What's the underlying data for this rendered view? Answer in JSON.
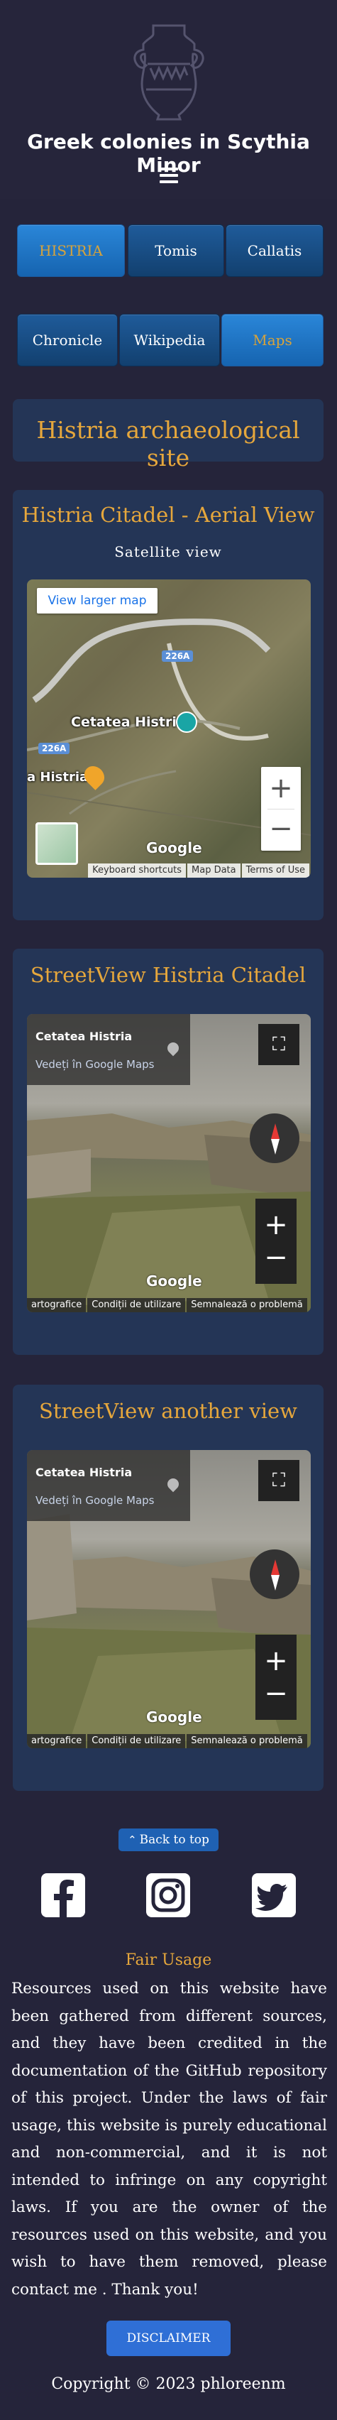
{
  "site": {
    "title": "Greek colonies in Scythia Minor"
  },
  "nav": {
    "row1": [
      "HISTRIA",
      "Tomis",
      "Callatis"
    ],
    "row2": [
      "Chronicle",
      "Wikipedia",
      "Maps"
    ],
    "active": [
      "HISTRIA",
      "Maps"
    ]
  },
  "page": {
    "title": "Histria archaeological site"
  },
  "aerial": {
    "title": "Histria Citadel - Aerial View",
    "subtitle": "Satellite view",
    "larger_map": "View larger map",
    "road1": "226A",
    "road2": "226A",
    "place": "Cetatea Histria",
    "place2": "a Histria",
    "google": "Google",
    "footer": [
      "Keyboard shortcuts",
      "Map Data",
      "Terms of Use"
    ]
  },
  "sv1": {
    "title": "StreetView Histria Citadel",
    "place": "Cetatea Histria",
    "link": "Vedeți în Google Maps",
    "google": "Google",
    "footer": [
      "artografice",
      "Condiții de utilizare",
      "Semnalează o problemă"
    ]
  },
  "sv2": {
    "title": "StreetView another view",
    "place": "Cetatea Histria",
    "link": "Vedeți în Google Maps",
    "google": "Google",
    "footer": [
      "artografice",
      "Condiții de utilizare",
      "Semnalează o problemă"
    ]
  },
  "footer": {
    "back_to_top": "Back to top",
    "fair_title": "Fair Usage",
    "fair_text": "Resources used on this website have been gathered from different sources, and they have been credited in the documentation of the GitHub repository of this project. Under the laws of fair usage, this website is purely educational and non-commercial, and it is not intended to infringe on any copyright laws. If you are the owner of the resources used on this website, and you wish to have them removed, please contact me . Thank you!",
    "disclaimer": "DISCLAIMER",
    "copyright": "Copyright © 2023 phloreenm"
  },
  "icons": [
    "amphora-logo-icon",
    "facebook-icon",
    "instagram-icon",
    "twitter-icon"
  ],
  "colors": {
    "background": "#25243a",
    "card": "#243556",
    "accent": "#e6a73c",
    "button": "#1f5b9a"
  }
}
